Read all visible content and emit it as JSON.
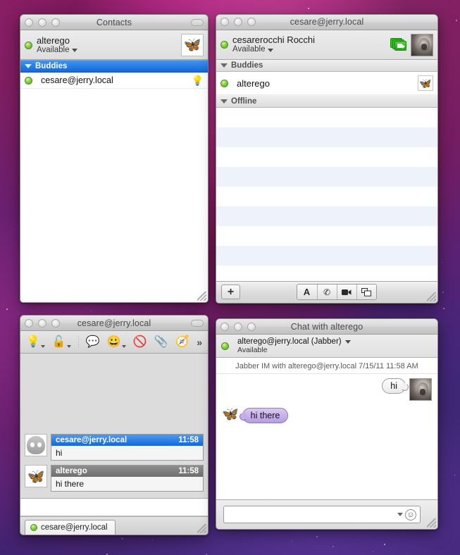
{
  "desktop": {
    "wallpaper_name": "purple-space-wallpaper"
  },
  "contacts_window": {
    "title": "Contacts",
    "account": {
      "name": "alterego",
      "status": "Available",
      "status_dot": "online-green",
      "avatar": "butterfly-icon"
    },
    "groups": [
      {
        "label": "Buddies",
        "selected": true
      }
    ],
    "buddies": [
      {
        "name": "cesare@jerry.local",
        "status_dot": "online-green",
        "badge": "lightbulb-icon"
      }
    ]
  },
  "buddylist_window": {
    "title": "cesare@jerry.local",
    "account": {
      "name": "cesarerocchi Rocchi",
      "status": "Available",
      "status_dot": "online-green",
      "avatar": "photo-avatar",
      "video_icon": "video-camera-icon"
    },
    "groups": [
      {
        "label": "Buddies"
      },
      {
        "label": "Offline"
      }
    ],
    "buddies": [
      {
        "name": "alterego",
        "status_dot": "online-green",
        "avatar": "butterfly-icon"
      }
    ],
    "toolbar": {
      "add_label": "+",
      "segments": [
        {
          "label": "A",
          "name": "text-chat-icon"
        },
        {
          "label": "☎",
          "name": "audio-chat-icon"
        },
        {
          "label": "■",
          "name": "video-chat-icon"
        },
        {
          "label": "❐",
          "name": "screen-share-icon"
        }
      ]
    }
  },
  "ichat_window": {
    "title": "cesare@jerry.local",
    "toolbar_icons": [
      "lightbulb-icon",
      "unlocked-padlock-icon",
      "chat-bubble-icon",
      "smiley-icon",
      "block-bubble-icon",
      "paperclip-icon",
      "compass-icon",
      "overflow-chevrons"
    ],
    "messages": [
      {
        "sender": "cesare@jerry.local",
        "time": "11:58",
        "text": "hi",
        "selected": true,
        "avatar": "ghost-icon"
      },
      {
        "sender": "alterego",
        "time": "11:58",
        "text": "hi there",
        "selected": false,
        "avatar": "butterfly-icon"
      }
    ],
    "tab": {
      "label": "cesare@jerry.local",
      "status_dot": "online-green"
    }
  },
  "chat_window": {
    "title": "Chat with alterego",
    "header": {
      "buddy": "alterego@jerry.local (Jabber)",
      "status": "Available",
      "status_dot": "online-green"
    },
    "meta": "Jabber IM with alterego@jerry.local   7/15/11 11:58 AM",
    "messages": [
      {
        "from": "me",
        "text": "hi",
        "avatar": "photo-avatar"
      },
      {
        "from": "them",
        "text": "hi there",
        "avatar": "butterfly-icon"
      }
    ],
    "input": {
      "value": "",
      "placeholder": "",
      "emoticon_icon": "smiley-picker-icon"
    }
  },
  "colors": {
    "selection_blue": "#1668d8",
    "online_green": "#8ed44a",
    "them_bubble_purple": "#b79de2",
    "stripe_blue": "#edf2fb"
  }
}
